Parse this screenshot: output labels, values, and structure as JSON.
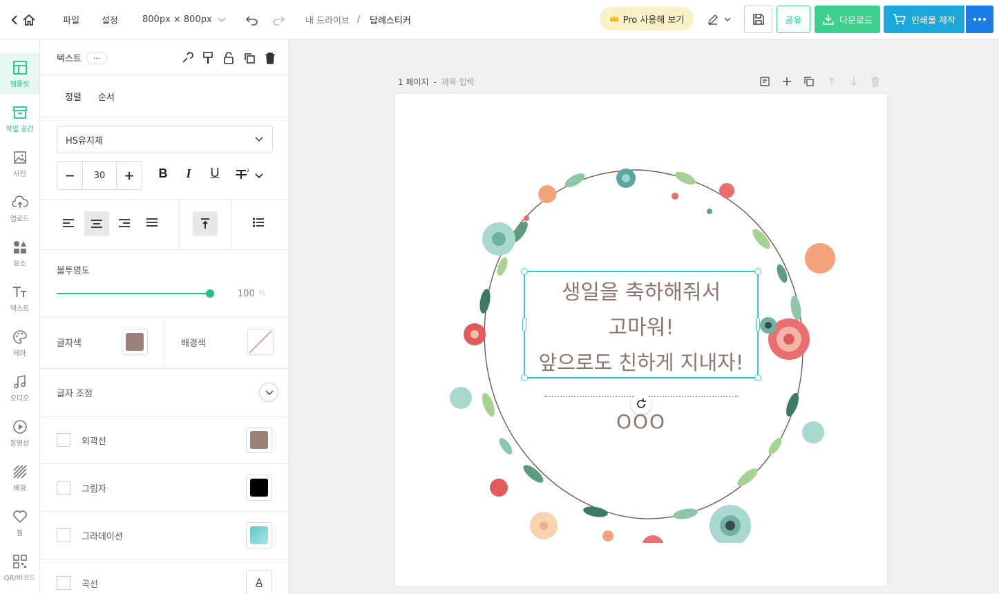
{
  "header": {
    "menu_file": "파일",
    "menu_settings": "설정",
    "canvas_size": "800px × 800px",
    "breadcrumb_root": "내 드라이브",
    "breadcrumb_separator": "/",
    "document_title": "답례스티커",
    "pro_label": "Pro 사용해 보기",
    "share_label": "공유",
    "download_label": "다운로드",
    "print_label": "인쇄물 제작"
  },
  "rail": {
    "items": [
      {
        "label": "템플릿"
      },
      {
        "label": "작업 공간"
      },
      {
        "label": "사진"
      },
      {
        "label": "업로드"
      },
      {
        "label": "요소"
      },
      {
        "label": "텍스트"
      },
      {
        "label": "테마"
      },
      {
        "label": "오디오"
      },
      {
        "label": "동영상"
      },
      {
        "label": "배경"
      },
      {
        "label": "찜"
      },
      {
        "label": "QR/바코드"
      }
    ]
  },
  "panel": {
    "title": "텍스트",
    "more": "···",
    "tab_align": "정렬",
    "tab_order": "순서",
    "font_name": "HS유지체",
    "font_size": "30",
    "minus": "−",
    "plus": "+",
    "bold": "B",
    "italic": "I",
    "underline": "U",
    "opacity_label": "불투명도",
    "opacity_value": "100",
    "opacity_unit": "%",
    "opacity_level": 1.0,
    "text_color_label": "글자색",
    "bg_color_label": "배경색",
    "adjust_label": "글자 조정",
    "outline_label": "외곽선",
    "shadow_label": "그림자",
    "gradient_label": "그라데이션",
    "curve_label": "곡선",
    "curve_glyph": "A"
  },
  "canvas": {
    "page_label": "1 페이지",
    "page_title_sep": "-",
    "page_title_placeholder": "제목 입력",
    "text_line1": "생일을 축하해줘서",
    "text_line2": "고마워!",
    "text_line3": "앞으로도 친하게 지내자!",
    "name_text": "OOO"
  },
  "colors": {
    "accent": "#1fbf8f",
    "text_color": "#9a8279",
    "selection": "#34c5d6",
    "download_btn": "#3ecf8e",
    "print_btn": "#1ba7d9",
    "more_btn": "#1a7ee6",
    "pro_badge": "#fbf1c6"
  }
}
